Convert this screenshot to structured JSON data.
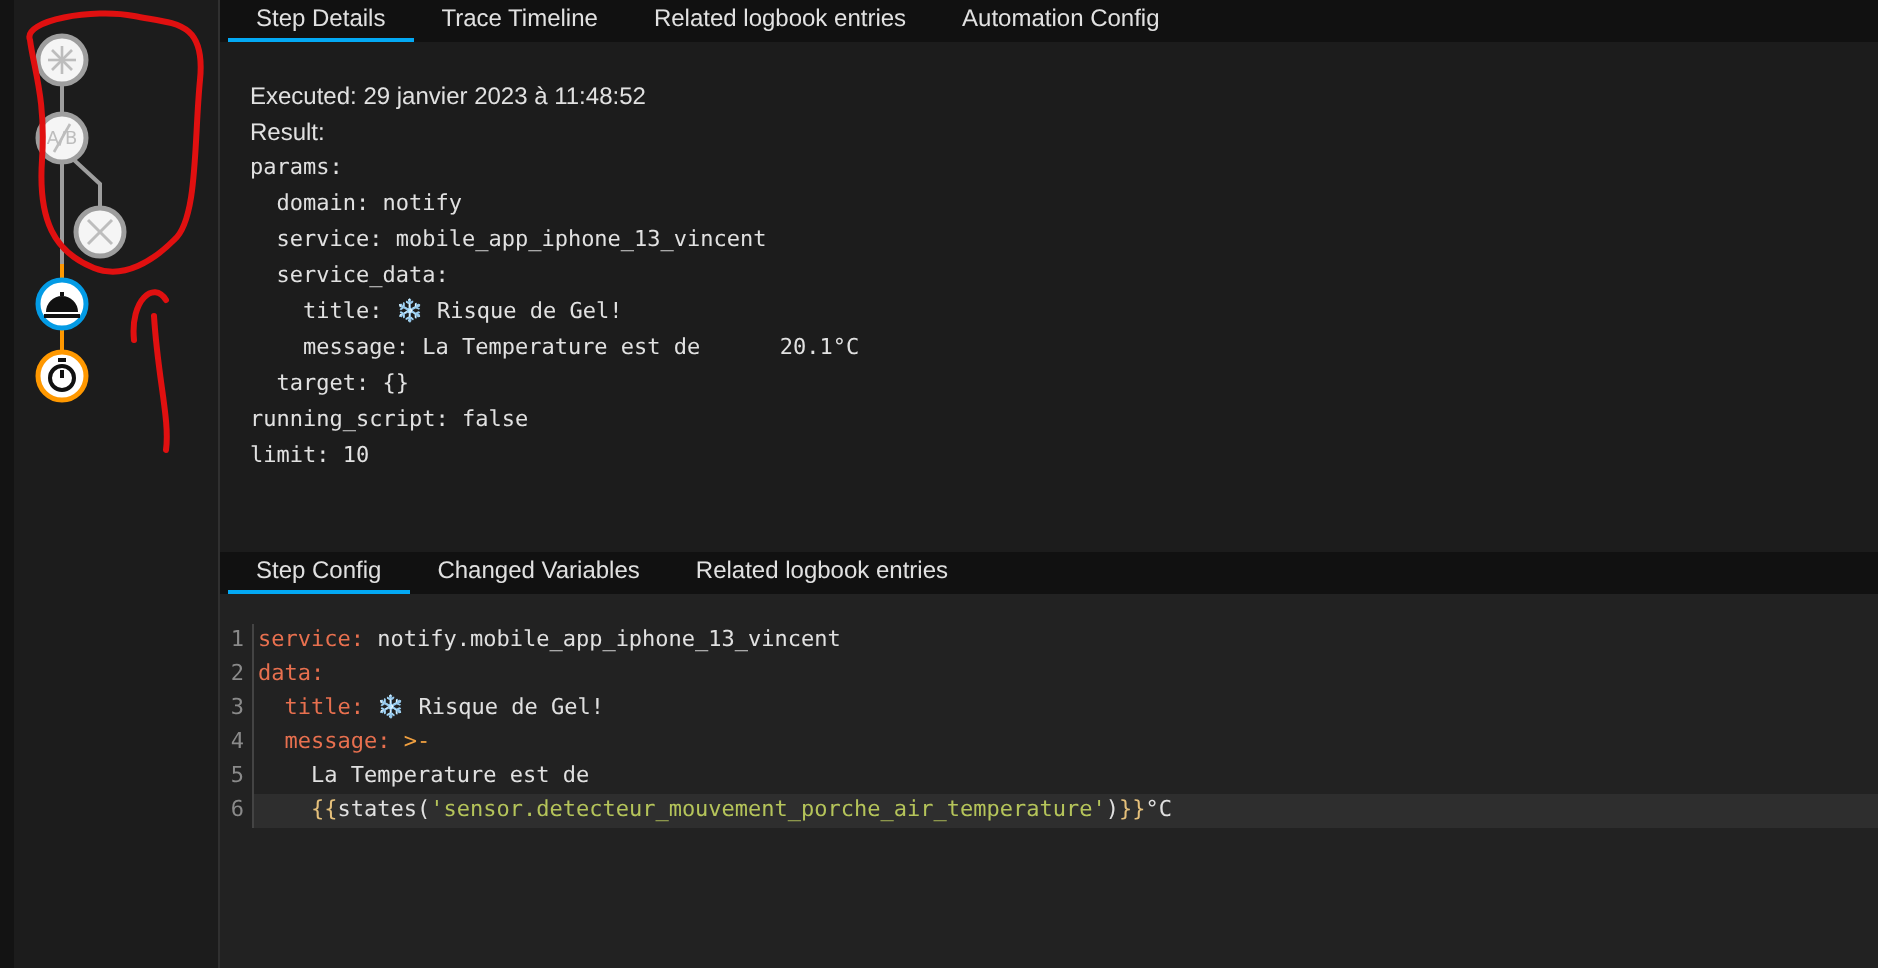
{
  "graph": {
    "nodes": [
      {
        "kind": "trigger",
        "color": "#9e9e9e"
      },
      {
        "kind": "condition",
        "color": "#9e9e9e",
        "label": "A/B"
      },
      {
        "kind": "skipped",
        "color": "#9e9e9e"
      },
      {
        "kind": "service",
        "color": "#039be5"
      },
      {
        "kind": "delay",
        "color": "#ff9800"
      }
    ]
  },
  "details_tabs": [
    {
      "label": "Step Details",
      "selected": true
    },
    {
      "label": "Trace Timeline",
      "selected": false
    },
    {
      "label": "Related logbook entries",
      "selected": false
    },
    {
      "label": "Automation Config",
      "selected": false
    }
  ],
  "summary": [
    "Executed: 29 janvier 2023 à 11:48:52",
    "Result:"
  ],
  "result_lines": [
    "params:",
    "  domain: notify",
    "  service: mobile_app_iphone_13_vincent",
    "  service_data:",
    "    title: ❄️ Risque de Gel!",
    "    message: La Temperature est de      20.1°C",
    "  target: {}",
    "running_script: false",
    "limit: 10"
  ],
  "config_tabs": [
    {
      "label": "Step Config",
      "selected": true
    },
    {
      "label": "Changed Variables",
      "selected": false
    },
    {
      "label": "Related logbook entries",
      "selected": false
    }
  ],
  "config_lines": [
    {
      "number": "1",
      "highlighted": false,
      "tokens": [
        {
          "kind": "key",
          "text": "service:"
        },
        {
          "kind": "plain",
          "text": " notify.mobile_app_iphone_13_vincent"
        }
      ]
    },
    {
      "number": "2",
      "highlighted": false,
      "tokens": [
        {
          "kind": "key",
          "text": "data:"
        }
      ]
    },
    {
      "number": "3",
      "highlighted": false,
      "tokens": [
        {
          "kind": "key",
          "text": "  title:"
        },
        {
          "kind": "plain",
          "text": " ❄️ Risque de Gel!"
        }
      ]
    },
    {
      "number": "4",
      "highlighted": false,
      "tokens": [
        {
          "kind": "key",
          "text": "  message:"
        },
        {
          "kind": "operator",
          "text": " >-"
        }
      ]
    },
    {
      "number": "5",
      "highlighted": false,
      "tokens": [
        {
          "kind": "plain",
          "text": "    La Temperature est de"
        }
      ]
    },
    {
      "number": "6",
      "highlighted": true,
      "tokens": [
        {
          "kind": "brace",
          "text": "    {{"
        },
        {
          "kind": "plain",
          "text": "states("
        },
        {
          "kind": "string",
          "text": "'sensor.detecteur_mouvement_porche_air_temperature'"
        },
        {
          "kind": "plain",
          "text": ")"
        },
        {
          "kind": "brace",
          "text": "}}"
        },
        {
          "kind": "plain",
          "text": "°C"
        }
      ]
    }
  ]
}
